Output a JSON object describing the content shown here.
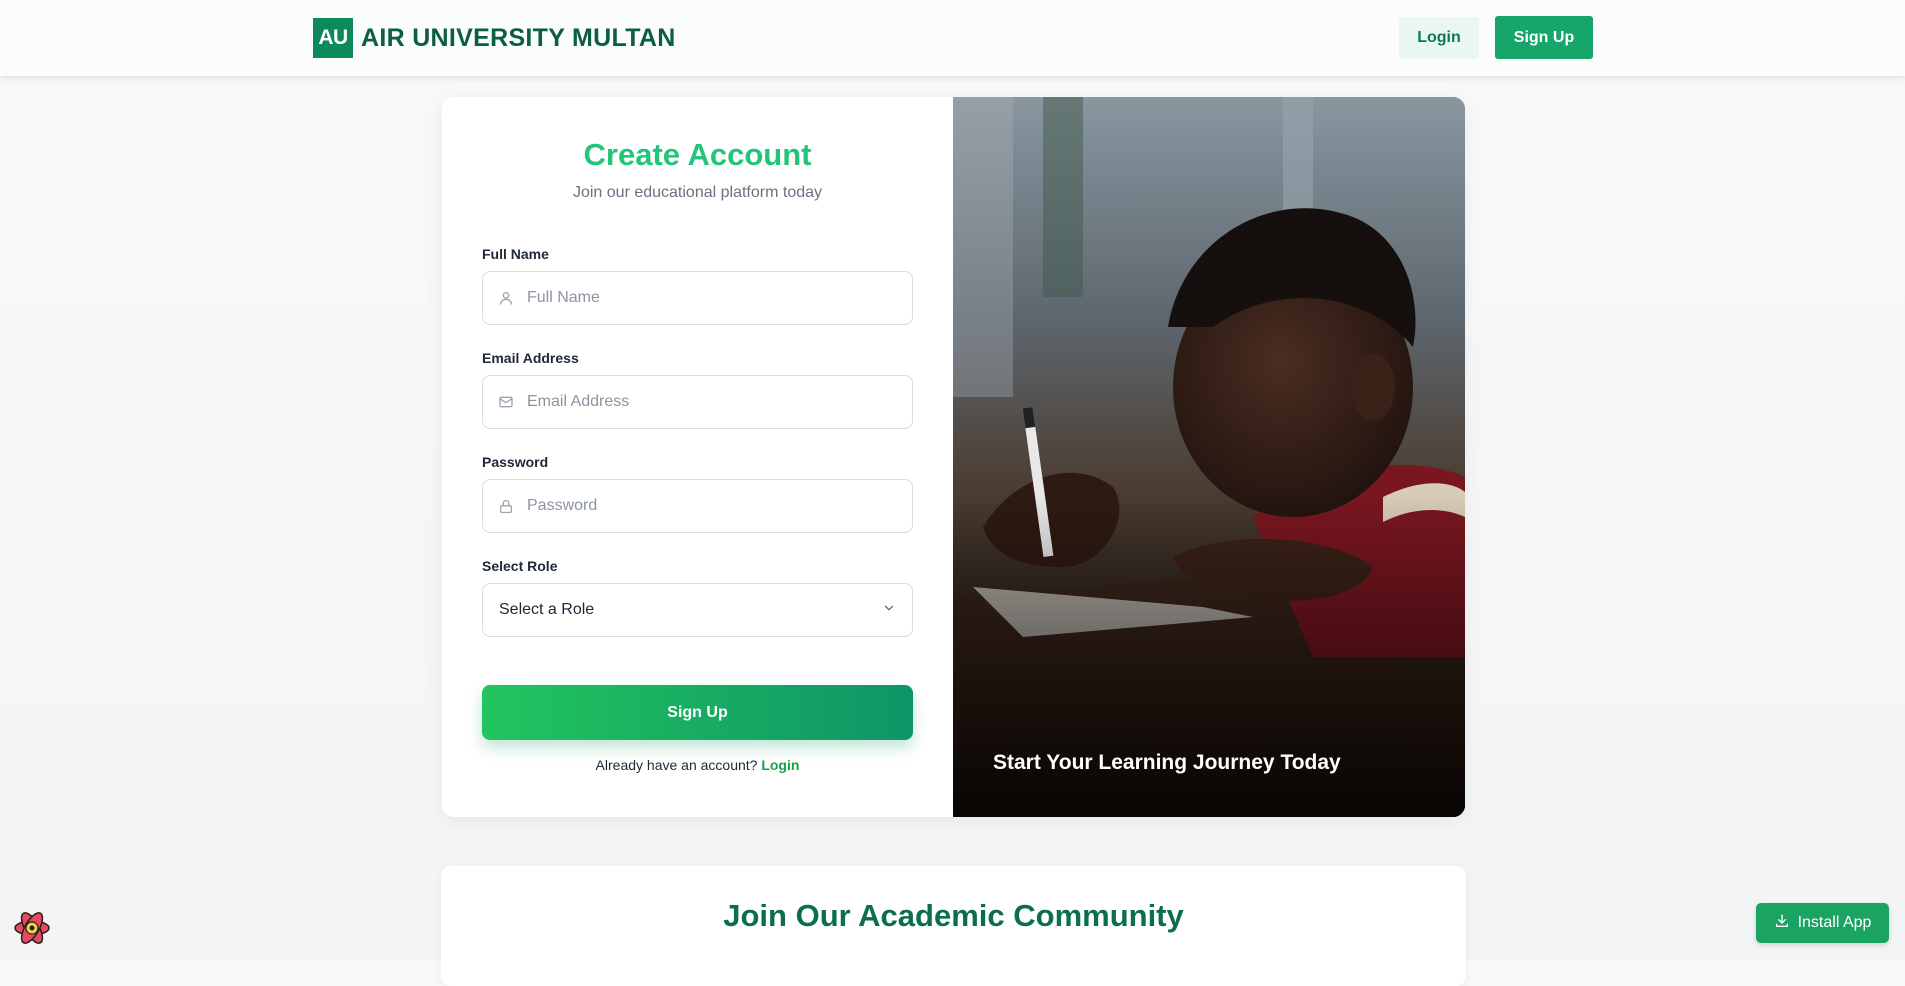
{
  "header": {
    "logo_badge": "AU",
    "brand_name": "AIR UNIVERSITY MULTAN",
    "login_label": "Login",
    "signup_label": "Sign Up"
  },
  "form": {
    "title": "Create Account",
    "subtitle": "Join our educational platform today",
    "full_name": {
      "label": "Full Name",
      "placeholder": "Full Name",
      "icon": "user-icon"
    },
    "email": {
      "label": "Email Address",
      "placeholder": "Email Address",
      "icon": "mail-icon"
    },
    "password": {
      "label": "Password",
      "placeholder": "Password",
      "icon": "lock-icon"
    },
    "role": {
      "label": "Select Role",
      "selected": "Select a Role",
      "icon": "chevron-down-icon"
    },
    "submit_label": "Sign Up",
    "login_prompt": "Already have an account?",
    "login_link": "Login"
  },
  "hero": {
    "caption": "Start Your Learning Journey Today"
  },
  "community": {
    "title": "Join Our Academic Community"
  },
  "install": {
    "label": "Install App",
    "icon": "download-icon"
  },
  "colors": {
    "brand": "#0b8a5b",
    "accent": "#22c57a",
    "button_gradient_start": "#22c55e",
    "button_gradient_end": "#0e9568"
  }
}
